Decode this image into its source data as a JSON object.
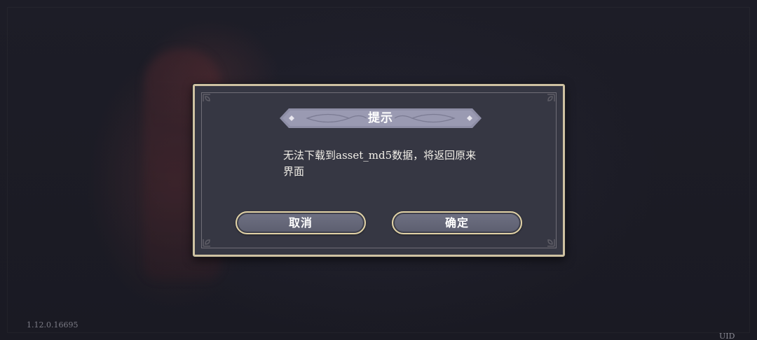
{
  "dialog": {
    "title": "提示",
    "message_line1": "无法下载到asset_md5数据，将返回原来",
    "message_line2": "界面",
    "cancel_label": "取消",
    "confirm_label": "确定"
  },
  "footer": {
    "version": "1.12.0.16695",
    "uid_label": "UID"
  },
  "colors": {
    "dialog_bg": "#363743",
    "dialog_border": "#cfc2a2",
    "button_bg": "#666879",
    "button_border": "#e2d3a6",
    "banner_bg": "#8e8ea6"
  },
  "icons": {
    "corners": "ornament-corner-icon",
    "banner": "title-banner-ornament"
  }
}
